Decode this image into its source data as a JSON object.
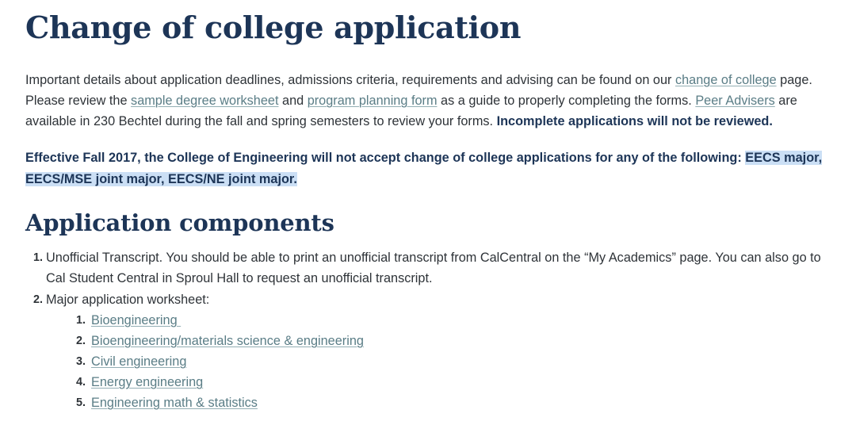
{
  "document": {
    "title": "Change of college application",
    "intro": {
      "seg1": "Important details about application deadlines, admissions criteria, requirements and advising can be found on our ",
      "link1": "change of college",
      "seg2": " page. Please review the ",
      "link2": "sample degree worksheet",
      "seg3": " and ",
      "link3": "program planning form",
      "seg4": " as a guide to properly completing the forms. ",
      "link4": "Peer Advisers",
      "seg5": " are available in 230 Bechtel during the fall and spring semesters to review your forms. ",
      "bold_tail": "Incomplete applications will not be reviewed."
    },
    "notice": {
      "plain": "Effective Fall 2017, the College of Engineering will not accept change of college applications for any of the following: ",
      "highlighted": "EECS major, EECS/MSE joint major, EECS/NE joint major."
    },
    "section_heading": "Application components",
    "components": [
      {
        "text": "Unofficial Transcript. You should be able to print an unofficial transcript from CalCentral on the “My Academics” page.  You can also go to Cal Student Central in Sproul Hall to request an unofficial transcript.",
        "sub_items": []
      },
      {
        "text": "Major application worksheet:",
        "sub_items": [
          "Bioengineering ",
          "Bioengineering/materials science & engineering",
          "Civil engineering",
          "Energy engineering",
          "Engineering math & statistics"
        ]
      }
    ]
  },
  "colors": {
    "heading": "#1d3557",
    "body_text": "#2e3338",
    "link": "#5a7d86",
    "highlight": "#cbdff5",
    "background": "#ffffff"
  }
}
